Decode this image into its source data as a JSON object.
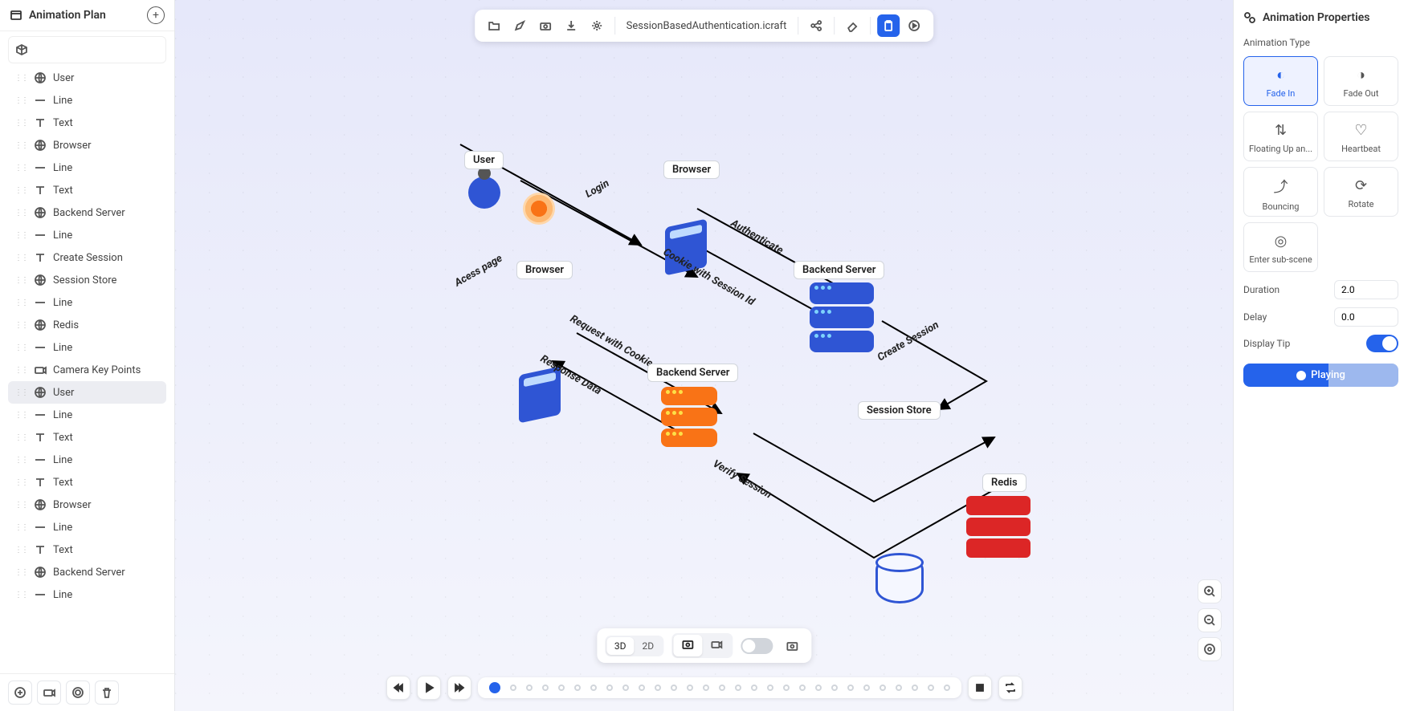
{
  "leftPanel": {
    "title": "Animation Plan",
    "items": [
      {
        "label": "",
        "icon": "cube"
      },
      {
        "label": "User",
        "icon": "globe"
      },
      {
        "label": "Line",
        "icon": "line"
      },
      {
        "label": "Text",
        "icon": "text"
      },
      {
        "label": "Browser",
        "icon": "globe"
      },
      {
        "label": "Line",
        "icon": "line"
      },
      {
        "label": "Text",
        "icon": "text"
      },
      {
        "label": "Backend Server",
        "icon": "globe"
      },
      {
        "label": "Line",
        "icon": "line"
      },
      {
        "label": "Create Session",
        "icon": "text"
      },
      {
        "label": "Session Store",
        "icon": "globe"
      },
      {
        "label": "Line",
        "icon": "line"
      },
      {
        "label": "Redis",
        "icon": "globe"
      },
      {
        "label": "Line",
        "icon": "line"
      },
      {
        "label": "Camera Key Points",
        "icon": "camera"
      },
      {
        "label": "User",
        "icon": "globe",
        "selected": true
      },
      {
        "label": "Line",
        "icon": "line"
      },
      {
        "label": "Text",
        "icon": "text"
      },
      {
        "label": "Line",
        "icon": "line"
      },
      {
        "label": "Text",
        "icon": "text"
      },
      {
        "label": "Browser",
        "icon": "globe"
      },
      {
        "label": "Line",
        "icon": "line"
      },
      {
        "label": "Text",
        "icon": "text"
      },
      {
        "label": "Backend Server",
        "icon": "globe"
      },
      {
        "label": "Line",
        "icon": "line"
      }
    ]
  },
  "toolbar": {
    "filename": "SessionBasedAuthentication.icraft"
  },
  "canvas": {
    "nodes": {
      "user": "User",
      "browser1": "Browser",
      "browser2": "Browser",
      "backend1": "Backend Server",
      "backend2": "Backend Server",
      "sessionStore": "Session Store",
      "redis": "Redis"
    },
    "edges": {
      "login": "Login",
      "authenticate": "Authenticate",
      "cookie": "Cookie with Session Id",
      "accessPage": "Acess page",
      "requestCookie": "Request with Cookie",
      "responseData": "Response Data",
      "createSession": "Create Session",
      "verifySession": "Verify Session"
    }
  },
  "viewToolbar": {
    "mode3d": "3D",
    "mode2d": "2D"
  },
  "rightPanel": {
    "title": "Animation Properties",
    "typeLabel": "Animation Type",
    "types": {
      "fadeIn": "Fade In",
      "fadeOut": "Fade Out",
      "floating": "Floating Up an...",
      "heartbeat": "Heartbeat",
      "bouncing": "Bouncing",
      "rotate": "Rotate",
      "subscene": "Enter sub-scene"
    },
    "durationLabel": "Duration",
    "durationValue": "2.0",
    "delayLabel": "Delay",
    "delayValue": "0.0",
    "displayTipLabel": "Display Tip",
    "playLabel": "Playing"
  },
  "timeline": {
    "totalFrames": 29,
    "currentFrame": 0
  }
}
